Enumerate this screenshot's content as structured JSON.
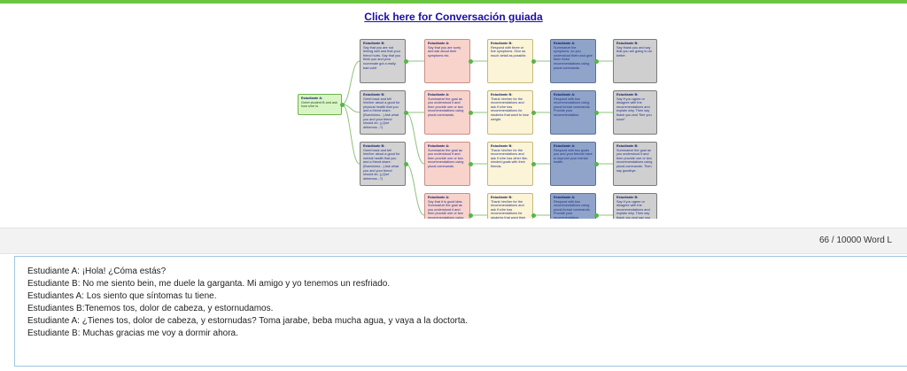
{
  "header": {
    "link_text": "Click here for Conversación guiada"
  },
  "diagram": {
    "columns": [
      [
        {
          "title": "Estudiante A:",
          "text": "Greet student B and ask how s/he is.",
          "color": "start"
        }
      ],
      [
        {
          "title": "Estudiante B:",
          "text": "Say that you are not feeling well and that your friend hurts. Say that you think you and your roommate got a really bad cold!",
          "color": "gray"
        },
        {
          "title": "Estudiante B:",
          "text": "Greet back and tell him/her about a good for physical health that you and a friend share. (Buenísimo...) Ask what you and your friend should do. (¿Qué debemos...?)",
          "color": "gray"
        },
        {
          "title": "Estudiante B:",
          "text": "Greet back and tell him/her about a good for mental health that you and a friend share. (Buenísimo...) Ask what you and your friend should do. (¿Qué debemos...?)",
          "color": "gray"
        }
      ],
      [
        {
          "title": "Estudiante A:",
          "text": "Say that you are sorry and ask about their symptoms etc.",
          "color": "red"
        },
        {
          "title": "Estudiante A:",
          "text": "Summarize the goal as you understood it and then provide one or two recommendations using plural commands.",
          "color": "red"
        },
        {
          "title": "Estudiante A:",
          "text": "Summarize the goal as you understood it and then provide one or two recommendations using plural commands.",
          "color": "red"
        },
        {
          "title": "Estudiante A:",
          "text": "Say that it is good idea. Summarize the goal as you understood it and then provide one or two recommendations using plural commands.",
          "color": "red"
        }
      ],
      [
        {
          "title": "Estudiante B:",
          "text": "Respond with three or five symptoms. Give as much detail as possible.",
          "color": "cream"
        },
        {
          "title": "Estudiante B:",
          "text": "Thank him/her for the recommendations and ask if s/he has recommendations for students that want to lose weight.",
          "color": "cream"
        },
        {
          "title": "Estudiante B:",
          "text": "Thank him/her for the recommendations and ask if s/he has other like-minded goals with their friends.",
          "color": "cream"
        },
        {
          "title": "Estudiante B:",
          "text": "Thank him/her for the recommendations and ask if s/he has recommendations for students that want their spirits...",
          "color": "cream"
        }
      ],
      [
        {
          "title": "Estudiante A:",
          "text": "Summarize the symptoms, so you understood them and give them three recommendations using plural commands.",
          "color": "blue"
        },
        {
          "title": "Estudiante A:",
          "text": "Respond with two recommendations using plural formal commands. Provide your recommendation.",
          "color": "blue"
        },
        {
          "title": "Estudiante A:",
          "text": "Respond with two goals you and your friends have to improve your mental health.",
          "color": "blue"
        },
        {
          "title": "Estudiante A:",
          "text": "Respond with two recommendations using plural formal commands. Provide your recommendation.",
          "color": "blue"
        }
      ],
      [
        {
          "title": "Estudiante B:",
          "text": "Say thank you and say that you are going to do better.",
          "color": "gray2"
        },
        {
          "title": "Estudiante B:",
          "text": "Say if you agree or disagree with the recommendations and explain why. Then say thank you and 'See you soon!'",
          "color": "gray2"
        },
        {
          "title": "Estudiante B:",
          "text": "Summarize the goal as you understood it and then provide one or two recommendations using plural commands. Then say goodbye.",
          "color": "gray2"
        },
        {
          "title": "Estudiante B:",
          "text": "Say if you agree or disagree with the recommendations and explain why. Then say thank you and say you have to study for class.",
          "color": "gray2"
        }
      ]
    ]
  },
  "word_counter": {
    "text": "66 / 10000 Word L"
  },
  "response": {
    "lines": [
      "Estudiante A: ¡Hola! ¿Cóma estás?",
      "Estudiante B: No me siento bein, me duele la garganta. Mi amigo y yo tenemos un resfriado.",
      "Estudiantes A: Los siento que síntomas tu tiene.",
      "Estudiantes B:Tenemos tos, dolor de cabeza, y estornudamos.",
      "Estudiante A: ¿Tienes tos, dolor de cabeza, y estornudas? Toma jarabe, beba mucha agua, y vaya a la doctorta.",
      "Estudiante B: Muchas gracias me voy a dormir ahora."
    ]
  },
  "colors": {
    "accent_green": "#6cc644",
    "link_blue": "#1a0dab",
    "textbox_border": "#9fc6e3"
  }
}
